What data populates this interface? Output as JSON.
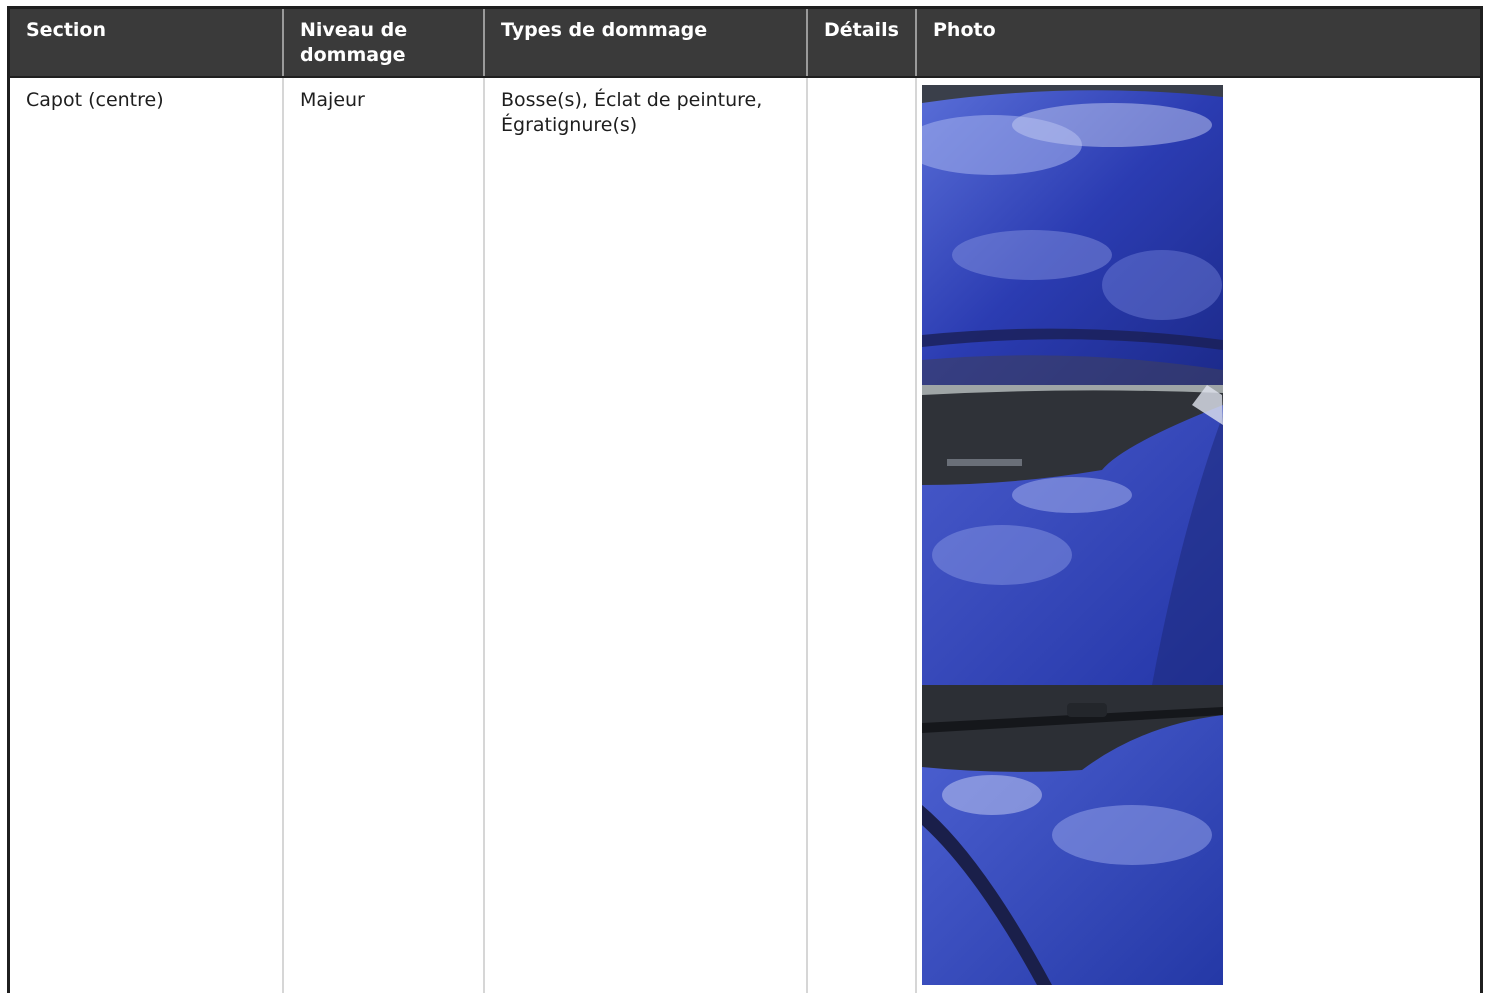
{
  "table": {
    "headers": [
      "Section",
      "Niveau de dommage",
      "Types de dommage",
      "Détails",
      "Photo"
    ],
    "rows": [
      {
        "section": "Capot (centre)",
        "level": "Majeur",
        "types": "Bosse(s), Éclat de peinture, Égratignure(s)",
        "details": "",
        "photos": [
          "car-hood-photo-1",
          "car-hood-photo-2",
          "car-hood-photo-3"
        ]
      }
    ]
  },
  "colors": {
    "header_bg": "#3a3a3a",
    "header_text": "#ffffff",
    "border": "#1f1f1f",
    "car_paint": "#2a3fb0"
  }
}
